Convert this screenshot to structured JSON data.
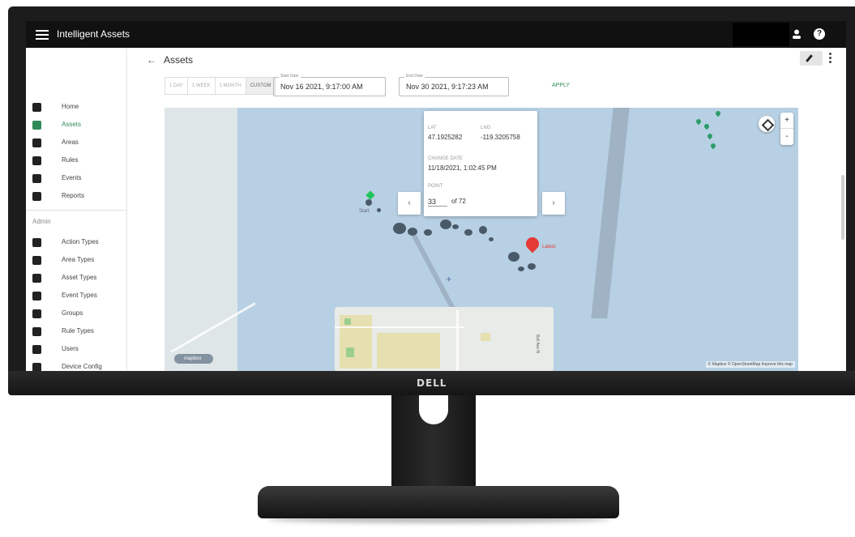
{
  "device": {
    "brand": "DELL"
  },
  "appbar": {
    "title": "Intelligent Assets"
  },
  "sidebar": {
    "items": [
      {
        "label": "Home"
      },
      {
        "label": "Assets"
      },
      {
        "label": "Areas"
      },
      {
        "label": "Rules"
      },
      {
        "label": "Events"
      },
      {
        "label": "Reports"
      }
    ],
    "admin_label": "Admin",
    "admin_items": [
      {
        "label": "Action Types"
      },
      {
        "label": "Area Types"
      },
      {
        "label": "Asset Types"
      },
      {
        "label": "Event Types"
      },
      {
        "label": "Groups"
      },
      {
        "label": "Rule Types"
      },
      {
        "label": "Users"
      },
      {
        "label": "Device Config"
      }
    ],
    "active_color": "#2e8b57"
  },
  "header": {
    "back_icon": "arrow-left-icon",
    "title": "Assets"
  },
  "filters": {
    "ranges": [
      "1 DAY",
      "1 WEEK",
      "1 MONTH",
      "CUSTOM"
    ],
    "selected_range": "CUSTOM",
    "start_label": "Start Date",
    "start_value": "Nov 16 2021, 9:17:00 AM",
    "end_label": "End Date",
    "end_value": "Nov 30 2021, 9:17:23 AM",
    "apply_label": "APPLY"
  },
  "map": {
    "popup": {
      "lat_label": "LAT",
      "lat_value": "47.1925282",
      "lng_label": "LNG",
      "lng_value": "-119.3205758",
      "change_date_label": "CHANGE DATE",
      "change_date_value": "11/18/2021, 1:02:45 PM",
      "point_label": "POINT",
      "point_value": "33",
      "point_total": "of 72"
    },
    "prev_arrow": "‹",
    "next_arrow": "›",
    "start_label": "Start",
    "end_label": "Latest",
    "zoom_in": "+",
    "zoom_out": "-",
    "logo_text": "mapbox",
    "attribution": "© Mapbox © OpenStreetMap Improve this map",
    "street_label": "Bell Ave N"
  }
}
